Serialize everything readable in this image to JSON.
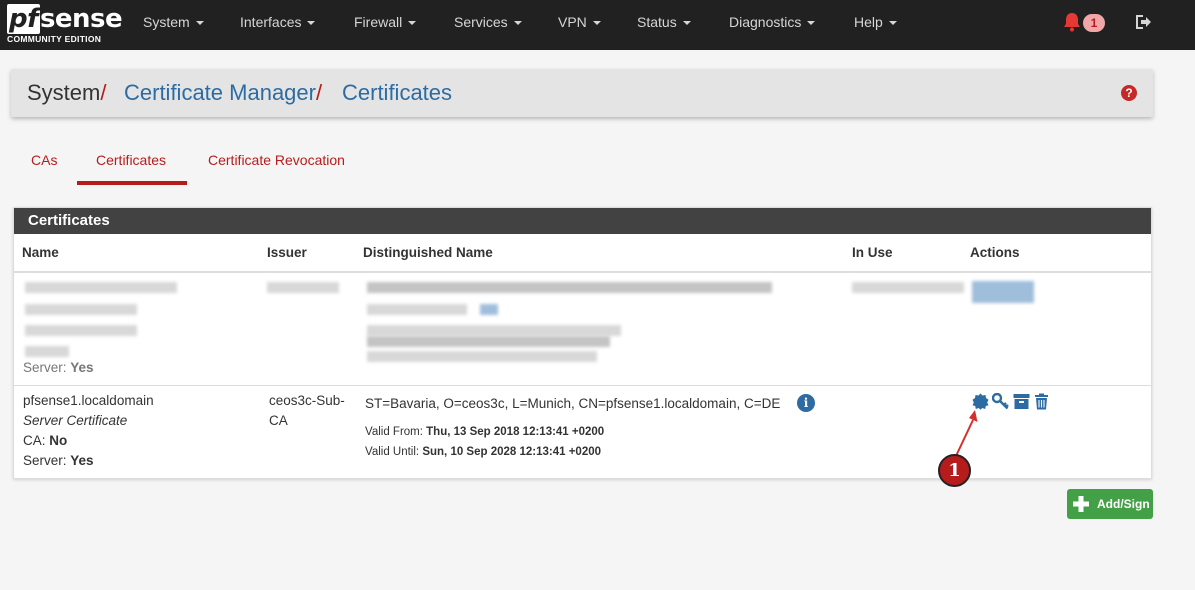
{
  "brand": {
    "logo_prefix": "pf",
    "logo_suffix": "sense",
    "edition": "COMMUNITY EDITION"
  },
  "nav": {
    "items": [
      {
        "label": "System"
      },
      {
        "label": "Interfaces"
      },
      {
        "label": "Firewall"
      },
      {
        "label": "Services"
      },
      {
        "label": "VPN"
      },
      {
        "label": "Status"
      },
      {
        "label": "Diagnostics"
      },
      {
        "label": "Help"
      }
    ],
    "notification_count": "1",
    "bell_icon": "bell-icon",
    "logout_icon": "logout-icon"
  },
  "breadcrumb": {
    "root": "System",
    "sep": "/",
    "level1": "Certificate Manager",
    "level2": "Certificates",
    "help_icon": "question-circle-icon",
    "help_glyph": "?"
  },
  "tabs": [
    {
      "label": "CAs"
    },
    {
      "label": "Certificates",
      "active": true
    },
    {
      "label": "Certificate Revocation"
    }
  ],
  "panel": {
    "title": "Certificates",
    "columns": [
      "Name",
      "Issuer",
      "Distinguished Name",
      "In Use",
      "Actions"
    ],
    "blurred_row": {
      "server_label": "Server:",
      "server_value": "Yes"
    },
    "row": {
      "name": "pfsense1.localdomain",
      "type": "Server Certificate",
      "ca_label": "CA:",
      "ca_value": "No",
      "server_label": "Server:",
      "server_value": "Yes",
      "issuer": "ceos3c-Sub-CA",
      "issuer_line1": "ceos3c-Sub-",
      "issuer_line2": "CA",
      "dn": "ST=Bavaria, O=ceos3c, L=Munich, CN=pfsense1.localdomain, C=DE",
      "info_glyph": "i",
      "valid_from_label": "Valid From:",
      "valid_from": "Thu, 13 Sep 2018 12:13:41 +0200",
      "valid_until_label": "Valid Until:",
      "valid_until": "Sun, 10 Sep 2028 12:13:41 +0200",
      "actions": [
        "certificate-icon",
        "key-icon",
        "archive-icon",
        "trash-icon"
      ]
    }
  },
  "annotation": {
    "number": "1"
  },
  "add_button": {
    "label": "Add/Sign",
    "icon": "plus-icon"
  },
  "colors": {
    "brand_red": "#b71c1c",
    "link_blue": "#2d6ca2",
    "nav_bg": "#212121",
    "success_green": "#43a047"
  }
}
